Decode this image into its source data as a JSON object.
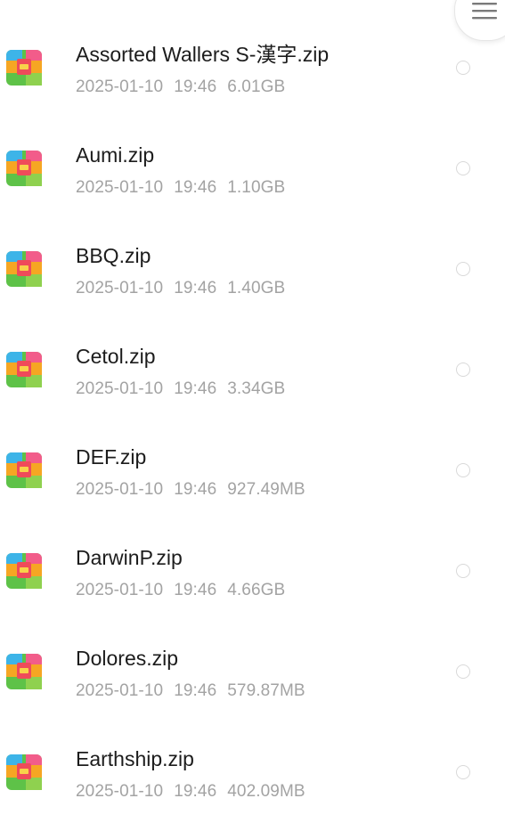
{
  "header": {
    "menu_icon": "menu-icon"
  },
  "files": [
    {
      "name": "Assorted Wallers S-漢字.zip",
      "date": "2025-01-10",
      "time": "19:46",
      "size": "6.01GB"
    },
    {
      "name": "Aumi.zip",
      "date": "2025-01-10",
      "time": "19:46",
      "size": "1.10GB"
    },
    {
      "name": "BBQ.zip",
      "date": "2025-01-10",
      "time": "19:46",
      "size": "1.40GB"
    },
    {
      "name": "Cetol.zip",
      "date": "2025-01-10",
      "time": "19:46",
      "size": "3.34GB"
    },
    {
      "name": "DEF.zip",
      "date": "2025-01-10",
      "time": "19:46",
      "size": "927.49MB"
    },
    {
      "name": "DarwinP.zip",
      "date": "2025-01-10",
      "time": "19:46",
      "size": "4.66GB"
    },
    {
      "name": "Dolores.zip",
      "date": "2025-01-10",
      "time": "19:46",
      "size": "579.87MB"
    },
    {
      "name": "Earthship.zip",
      "date": "2025-01-10",
      "time": "19:46",
      "size": "402.09MB"
    }
  ],
  "colors": {
    "icon_top_left": "#3db4e8",
    "icon_top_right": "#f25c8a",
    "icon_middle": "#f6a623",
    "icon_bottom_left": "#5ec248",
    "icon_bottom_right": "#8fd14f",
    "icon_strap": "#ef4b5a"
  }
}
